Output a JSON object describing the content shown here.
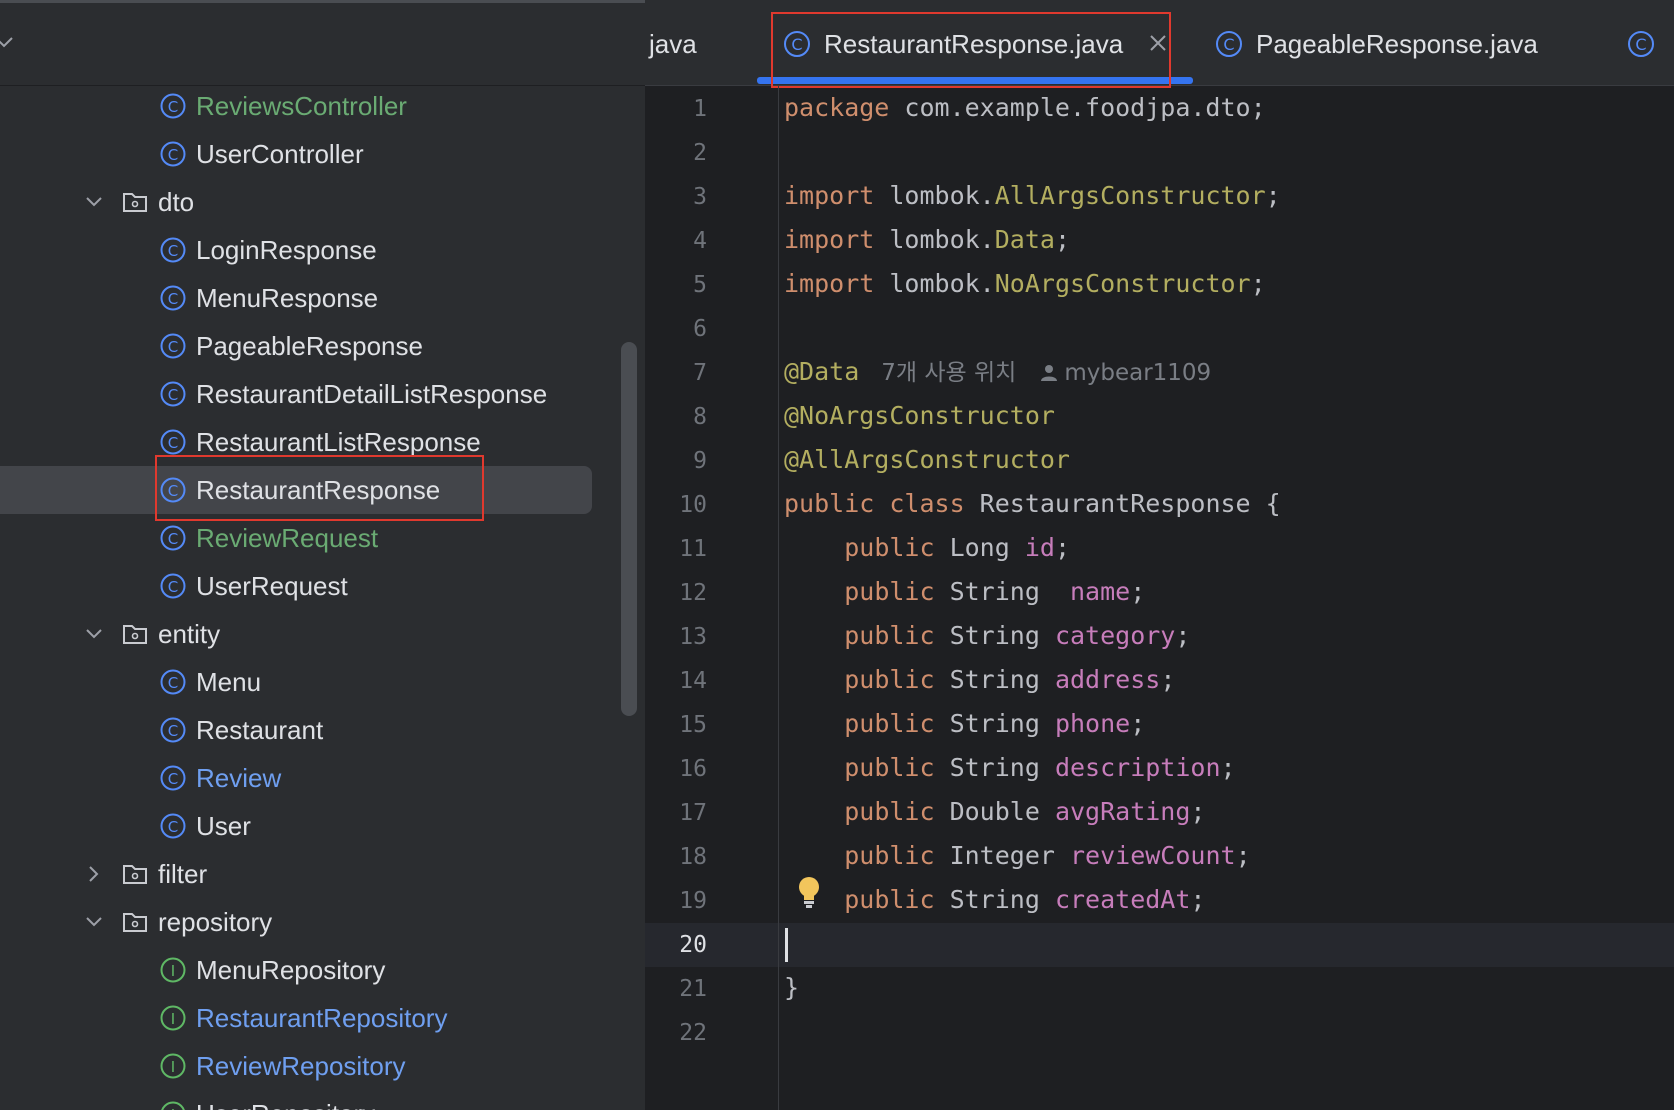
{
  "project": {
    "tree": [
      {
        "type": "class",
        "label": "ReviewsController",
        "color": "green"
      },
      {
        "type": "class",
        "label": "UserController",
        "color": "default"
      },
      {
        "type": "folder",
        "label": "dto",
        "expanded": true
      },
      {
        "type": "class",
        "label": "LoginResponse",
        "color": "default"
      },
      {
        "type": "class",
        "label": "MenuResponse",
        "color": "default"
      },
      {
        "type": "class",
        "label": "PageableResponse",
        "color": "default"
      },
      {
        "type": "class",
        "label": "RestaurantDetailListResponse",
        "color": "default"
      },
      {
        "type": "class",
        "label": "RestaurantListResponse",
        "color": "default"
      },
      {
        "type": "class",
        "label": "RestaurantResponse",
        "color": "default",
        "selected": true
      },
      {
        "type": "class",
        "label": "ReviewRequest",
        "color": "green"
      },
      {
        "type": "class",
        "label": "UserRequest",
        "color": "default"
      },
      {
        "type": "folder",
        "label": "entity",
        "expanded": true
      },
      {
        "type": "class",
        "label": "Menu",
        "color": "default"
      },
      {
        "type": "class",
        "label": "Restaurant",
        "color": "default"
      },
      {
        "type": "class",
        "label": "Review",
        "color": "blue"
      },
      {
        "type": "class",
        "label": "User",
        "color": "default"
      },
      {
        "type": "folder",
        "label": "filter",
        "expanded": false
      },
      {
        "type": "folder",
        "label": "repository",
        "expanded": true
      },
      {
        "type": "interface",
        "label": "MenuRepository",
        "color": "default"
      },
      {
        "type": "interface",
        "label": "RestaurantRepository",
        "color": "blue"
      },
      {
        "type": "interface",
        "label": "ReviewRepository",
        "color": "blue"
      },
      {
        "type": "interface",
        "label": "UserRepository",
        "color": "default"
      }
    ]
  },
  "tabs": {
    "left_partial": "java",
    "active": "RestaurantResponse.java",
    "next": "PageableResponse.java"
  },
  "editor": {
    "current_line": 20,
    "usage_hint": "7개 사용 위치",
    "author_hint": "mybear1109",
    "lines": [
      {
        "n": 1,
        "t": [
          [
            "kw",
            "package"
          ],
          [
            "p",
            " com.example.foodjpa.dto;"
          ]
        ]
      },
      {
        "n": 2,
        "t": []
      },
      {
        "n": 3,
        "t": [
          [
            "kw",
            "import"
          ],
          [
            "p",
            " lombok."
          ],
          [
            "ann",
            "AllArgsConstructor"
          ],
          [
            "p",
            ";"
          ]
        ]
      },
      {
        "n": 4,
        "t": [
          [
            "kw",
            "import"
          ],
          [
            "p",
            " lombok."
          ],
          [
            "ann",
            "Data"
          ],
          [
            "p",
            ";"
          ]
        ]
      },
      {
        "n": 5,
        "t": [
          [
            "kw",
            "import"
          ],
          [
            "p",
            " lombok."
          ],
          [
            "ann",
            "NoArgsConstructor"
          ],
          [
            "p",
            ";"
          ]
        ]
      },
      {
        "n": 6,
        "t": []
      },
      {
        "n": 7,
        "t": [
          [
            "ann",
            "@Data"
          ]
        ],
        "hint": true
      },
      {
        "n": 8,
        "t": [
          [
            "ann",
            "@NoArgsConstructor"
          ]
        ]
      },
      {
        "n": 9,
        "t": [
          [
            "ann",
            "@AllArgsConstructor"
          ]
        ]
      },
      {
        "n": 10,
        "t": [
          [
            "kw",
            "public class"
          ],
          [
            "p",
            " RestaurantResponse {"
          ]
        ]
      },
      {
        "n": 11,
        "t": [
          [
            "p",
            "    "
          ],
          [
            "kw",
            "public"
          ],
          [
            "p",
            " Long "
          ],
          [
            "fld",
            "id"
          ],
          [
            "p",
            ";"
          ]
        ]
      },
      {
        "n": 12,
        "t": [
          [
            "p",
            "    "
          ],
          [
            "kw",
            "public"
          ],
          [
            "p",
            " String  "
          ],
          [
            "fld",
            "name"
          ],
          [
            "p",
            ";"
          ]
        ]
      },
      {
        "n": 13,
        "t": [
          [
            "p",
            "    "
          ],
          [
            "kw",
            "public"
          ],
          [
            "p",
            " String "
          ],
          [
            "fld",
            "category"
          ],
          [
            "p",
            ";"
          ]
        ]
      },
      {
        "n": 14,
        "t": [
          [
            "p",
            "    "
          ],
          [
            "kw",
            "public"
          ],
          [
            "p",
            " String "
          ],
          [
            "fld",
            "address"
          ],
          [
            "p",
            ";"
          ]
        ]
      },
      {
        "n": 15,
        "t": [
          [
            "p",
            "    "
          ],
          [
            "kw",
            "public"
          ],
          [
            "p",
            " String "
          ],
          [
            "fld",
            "phone"
          ],
          [
            "p",
            ";"
          ]
        ]
      },
      {
        "n": 16,
        "t": [
          [
            "p",
            "    "
          ],
          [
            "kw",
            "public"
          ],
          [
            "p",
            " String "
          ],
          [
            "fld",
            "description"
          ],
          [
            "p",
            ";"
          ]
        ]
      },
      {
        "n": 17,
        "t": [
          [
            "p",
            "    "
          ],
          [
            "kw",
            "public"
          ],
          [
            "p",
            " Double "
          ],
          [
            "fld",
            "avgRating"
          ],
          [
            "p",
            ";"
          ]
        ]
      },
      {
        "n": 18,
        "t": [
          [
            "p",
            "    "
          ],
          [
            "kw",
            "public"
          ],
          [
            "p",
            " Integer "
          ],
          [
            "fld",
            "reviewCount"
          ],
          [
            "p",
            ";"
          ]
        ]
      },
      {
        "n": 19,
        "t": [
          [
            "p",
            "    "
          ],
          [
            "kw",
            "public"
          ],
          [
            "p",
            " String "
          ],
          [
            "fld",
            "createdAt"
          ],
          [
            "p",
            ";"
          ]
        ]
      },
      {
        "n": 20,
        "t": []
      },
      {
        "n": 21,
        "t": [
          [
            "p",
            "}"
          ]
        ]
      },
      {
        "n": 22,
        "t": []
      }
    ]
  },
  "colors": {
    "accent": "#3574f0",
    "highlight_box": "#e0392e",
    "keyword": "#cf8e6d",
    "annotation": "#b3ae60",
    "field": "#c77dbb"
  }
}
